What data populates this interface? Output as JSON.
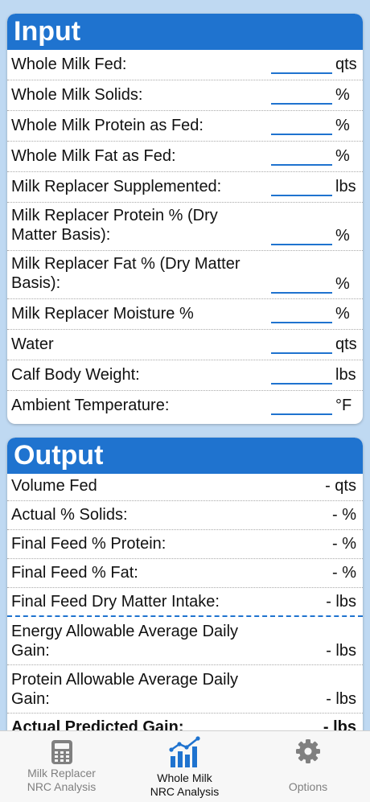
{
  "input": {
    "title": "Input",
    "rows": [
      {
        "label": "Whole Milk Fed:",
        "unit": "qts",
        "value": ""
      },
      {
        "label": "Whole Milk Solids:",
        "unit": "%",
        "value": ""
      },
      {
        "label": "Whole Milk Protein as Fed:",
        "unit": "%",
        "value": ""
      },
      {
        "label": "Whole Milk Fat as Fed:",
        "unit": "%",
        "value": ""
      },
      {
        "label": "Milk Replacer Supplemented:",
        "unit": "lbs",
        "value": ""
      },
      {
        "label_line1": "Milk Replacer Protein % (Dry",
        "label_line2": "Matter Basis):",
        "unit": "%",
        "value": ""
      },
      {
        "label_line1": "Milk Replacer Fat % (Dry Matter",
        "label_line2": "Basis):",
        "unit": "%",
        "value": ""
      },
      {
        "label": "Milk Replacer Moisture %",
        "unit": "%",
        "value": ""
      },
      {
        "label": "Water",
        "unit": "qts",
        "value": ""
      },
      {
        "label": "Calf Body Weight:",
        "unit": "lbs",
        "value": ""
      },
      {
        "label": "Ambient Temperature:",
        "unit": "°F",
        "value": ""
      }
    ]
  },
  "output": {
    "title": "Output",
    "rows": [
      {
        "label": "Volume Fed",
        "value": "- qts"
      },
      {
        "label": "Actual % Solids:",
        "value": "- %"
      },
      {
        "label": "Final Feed % Protein:",
        "value": "- %"
      },
      {
        "label": "Final Feed % Fat:",
        "value": "- %"
      },
      {
        "label": "Final Feed Dry Matter Intake:",
        "value": "- lbs"
      },
      {
        "label_line1": "Energy Allowable Average Daily",
        "label_line2": "Gain:",
        "value": "- lbs"
      },
      {
        "label_line1": "Protein Allowable Average Daily",
        "label_line2": "Gain:",
        "value": "- lbs"
      },
      {
        "label": "Actual Predicted Gain:",
        "value": "- lbs"
      }
    ]
  },
  "tabs": [
    {
      "label_line1": "Milk Replacer",
      "label_line2": "NRC Analysis",
      "icon": "calculator-icon",
      "active": false
    },
    {
      "label_line1": "Whole Milk",
      "label_line2": "NRC Analysis",
      "icon": "bar-chart-icon",
      "active": true
    },
    {
      "label": "Options",
      "icon": "gear-icon",
      "active": false
    }
  ],
  "colors": {
    "accent": "#1f73cf",
    "background": "#bfd9f2",
    "inactive_tab": "#808080"
  }
}
